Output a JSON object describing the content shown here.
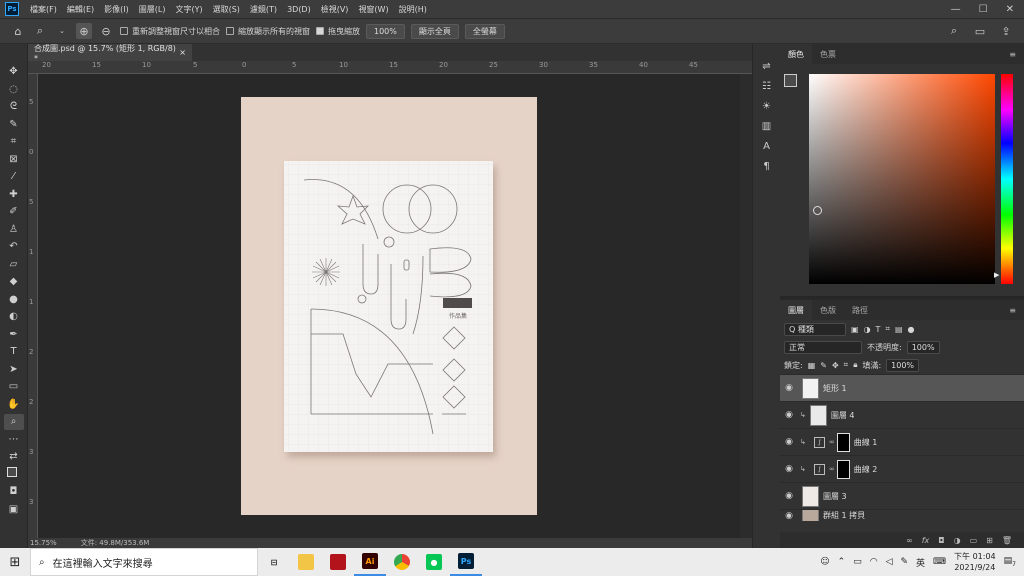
{
  "app": {
    "logo": "Ps"
  },
  "menu": [
    "檔案(F)",
    "編輯(E)",
    "影像(I)",
    "圖層(L)",
    "文字(Y)",
    "選取(S)",
    "濾鏡(T)",
    "3D(D)",
    "檢視(V)",
    "視窗(W)",
    "說明(H)"
  ],
  "window_controls": {
    "minimize": "—",
    "maximize": "☐",
    "close": "✕"
  },
  "options": {
    "resize_windows": "重新調整視窗尺寸以相合",
    "zoom_all": "縮放顯示所有的視窗",
    "scrubby_zoom": "拖曳縮放",
    "zoom_value": "100%",
    "fit_screen": "顯示全頁",
    "fill_screen": "全螢幕"
  },
  "document": {
    "tab": "合成圖.psd @ 15.7% (矩形 1, RGB/8) *",
    "close": "×"
  },
  "ruler_h": [
    "20",
    "15",
    "10",
    "5",
    "0",
    "5",
    "10",
    "15",
    "20",
    "25",
    "30",
    "35",
    "40",
    "45"
  ],
  "ruler_v": [
    "5",
    "0",
    "5",
    "1",
    "1",
    "2",
    "2",
    "3",
    "3"
  ],
  "artwork": {
    "title_label": "作品集"
  },
  "status": {
    "zoom": "15.75%",
    "file": "文件: 49.8M/353.6M"
  },
  "color_panel": {
    "tabs": [
      "顏色",
      "色票"
    ],
    "hue_hex": "#ff4700"
  },
  "layers_panel": {
    "tabs": [
      "圖層",
      "色版",
      "路徑"
    ],
    "filter": "Q 種類",
    "blend_mode": "正常",
    "opacity_label": "不透明度:",
    "opacity": "100%",
    "lock_label": "鎖定:",
    "fill_label": "填滿:",
    "fill": "100%",
    "layers": [
      {
        "name": "矩形 1"
      },
      {
        "name": "圖層 4"
      },
      {
        "name": "曲線 1"
      },
      {
        "name": "曲線 2"
      },
      {
        "name": "圖層 3"
      },
      {
        "name": "群組 1 拷貝"
      }
    ],
    "footer_icons": [
      "link-icon",
      "fx-icon",
      "mask-icon",
      "adjustment-icon",
      "group-icon",
      "new-layer-icon",
      "trash-icon"
    ]
  },
  "taskbar": {
    "search_placeholder": "在這裡輸入文字來搜尋",
    "apps": [
      "Ai",
      "Ps"
    ],
    "ime": "英",
    "time": "下午 01:04",
    "date": "2021/9/24",
    "notify_count": "7"
  }
}
